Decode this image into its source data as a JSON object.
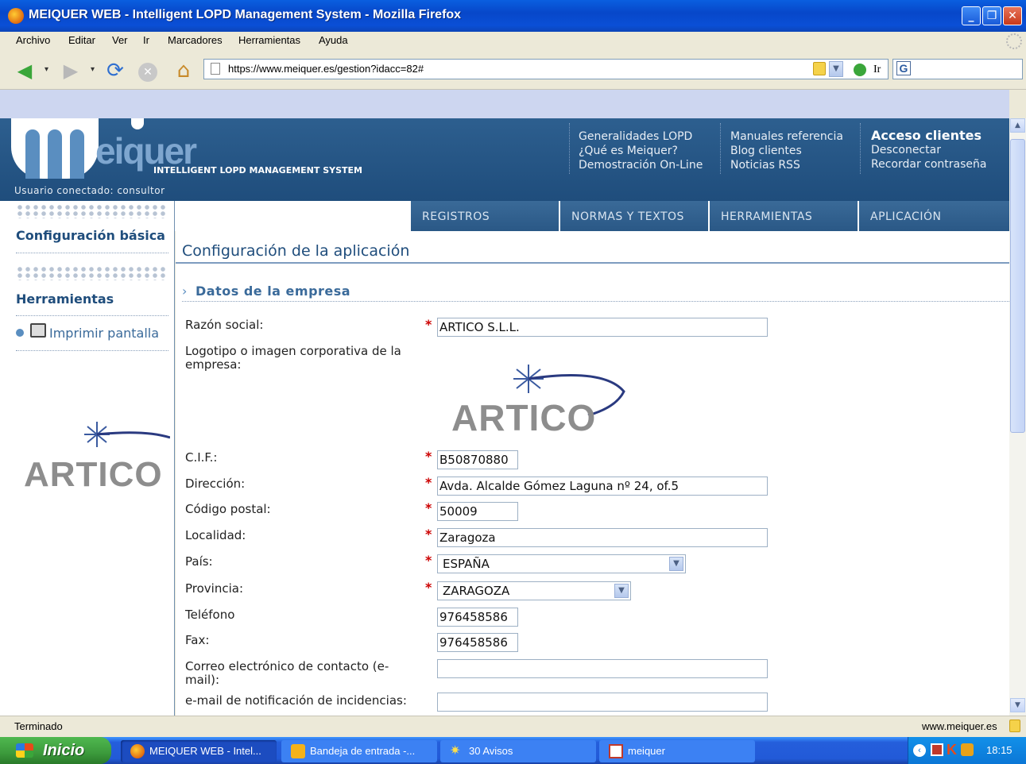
{
  "window": {
    "title": "MEIQUER WEB - Intelligent LOPD Management System - Mozilla Firefox",
    "minimize": "_",
    "restore": "❐",
    "close": "✕"
  },
  "menu": {
    "items": [
      "Archivo",
      "Editar",
      "Ver",
      "Ir",
      "Marcadores",
      "Herramientas",
      "Ayuda"
    ]
  },
  "nav": {
    "url": "https://www.meiquer.es/gestion?idacc=82#",
    "go_label": "Ir",
    "search_value": ""
  },
  "header": {
    "logo_text": "eiquer",
    "tagline": "INTELLIGENT LOPD MANAGEMENT SYSTEM",
    "user": "Usuario conectado: consultor",
    "col1": [
      "Generalidades LOPD",
      "¿Qué es Meiquer?",
      "Demostración On-Line"
    ],
    "col2": [
      "Manuales referencia",
      "Blog clientes",
      "Noticias RSS"
    ],
    "col3_title": "Acceso clientes",
    "col3": [
      "Desconectar",
      "Recordar contraseña"
    ]
  },
  "tabs": [
    "REGISTROS",
    "NORMAS Y TEXTOS",
    "HERRAMIENTAS",
    "APLICACIÓN"
  ],
  "sidebar": {
    "section1": "Configuración básica",
    "section2": "Herramientas",
    "print_label": "Imprimir pantalla",
    "logo_text": "ARTICO"
  },
  "page": {
    "title": "Configuración de la aplicación",
    "section": "Datos de la empresa",
    "logo_text": "ARTICO"
  },
  "form": {
    "razon_social_label": "Razón social:",
    "razon_social": "ARTICO S.L.L.",
    "logo_label": "Logotipo o imagen corporativa de la empresa:",
    "cif_label": "C.I.F.:",
    "cif": "B50870880",
    "direccion_label": "Dirección:",
    "direccion": "Avda. Alcalde Gómez Laguna nº 24, of.5",
    "cp_label": "Código postal:",
    "cp": "50009",
    "localidad_label": "Localidad:",
    "localidad": "Zaragoza",
    "pais_label": "País:",
    "pais": "ESPAÑA",
    "provincia_label": "Provincia:",
    "provincia": "ZARAGOZA",
    "telefono_label": "Teléfono",
    "telefono": "976458586",
    "fax_label": "Fax:",
    "fax": "976458586",
    "email_label": "Correo electrónico de contacto (e-mail):",
    "email": "",
    "email_incid_label": "e-mail de notificación de incidencias:",
    "email_incid": "",
    "required_mark": "*"
  },
  "status": {
    "left": "Terminado",
    "right": "www.meiquer.es"
  },
  "taskbar": {
    "start": "Inicio",
    "tasks": [
      "MEIQUER WEB - Intel...",
      "Bandeja de entrada -...",
      "30 Avisos",
      "meiquer"
    ],
    "clock": "18:15"
  },
  "colors": {
    "header_blue": "#1f4d7c",
    "tab_blue": "#2a5886",
    "required_red": "#cc0000"
  }
}
